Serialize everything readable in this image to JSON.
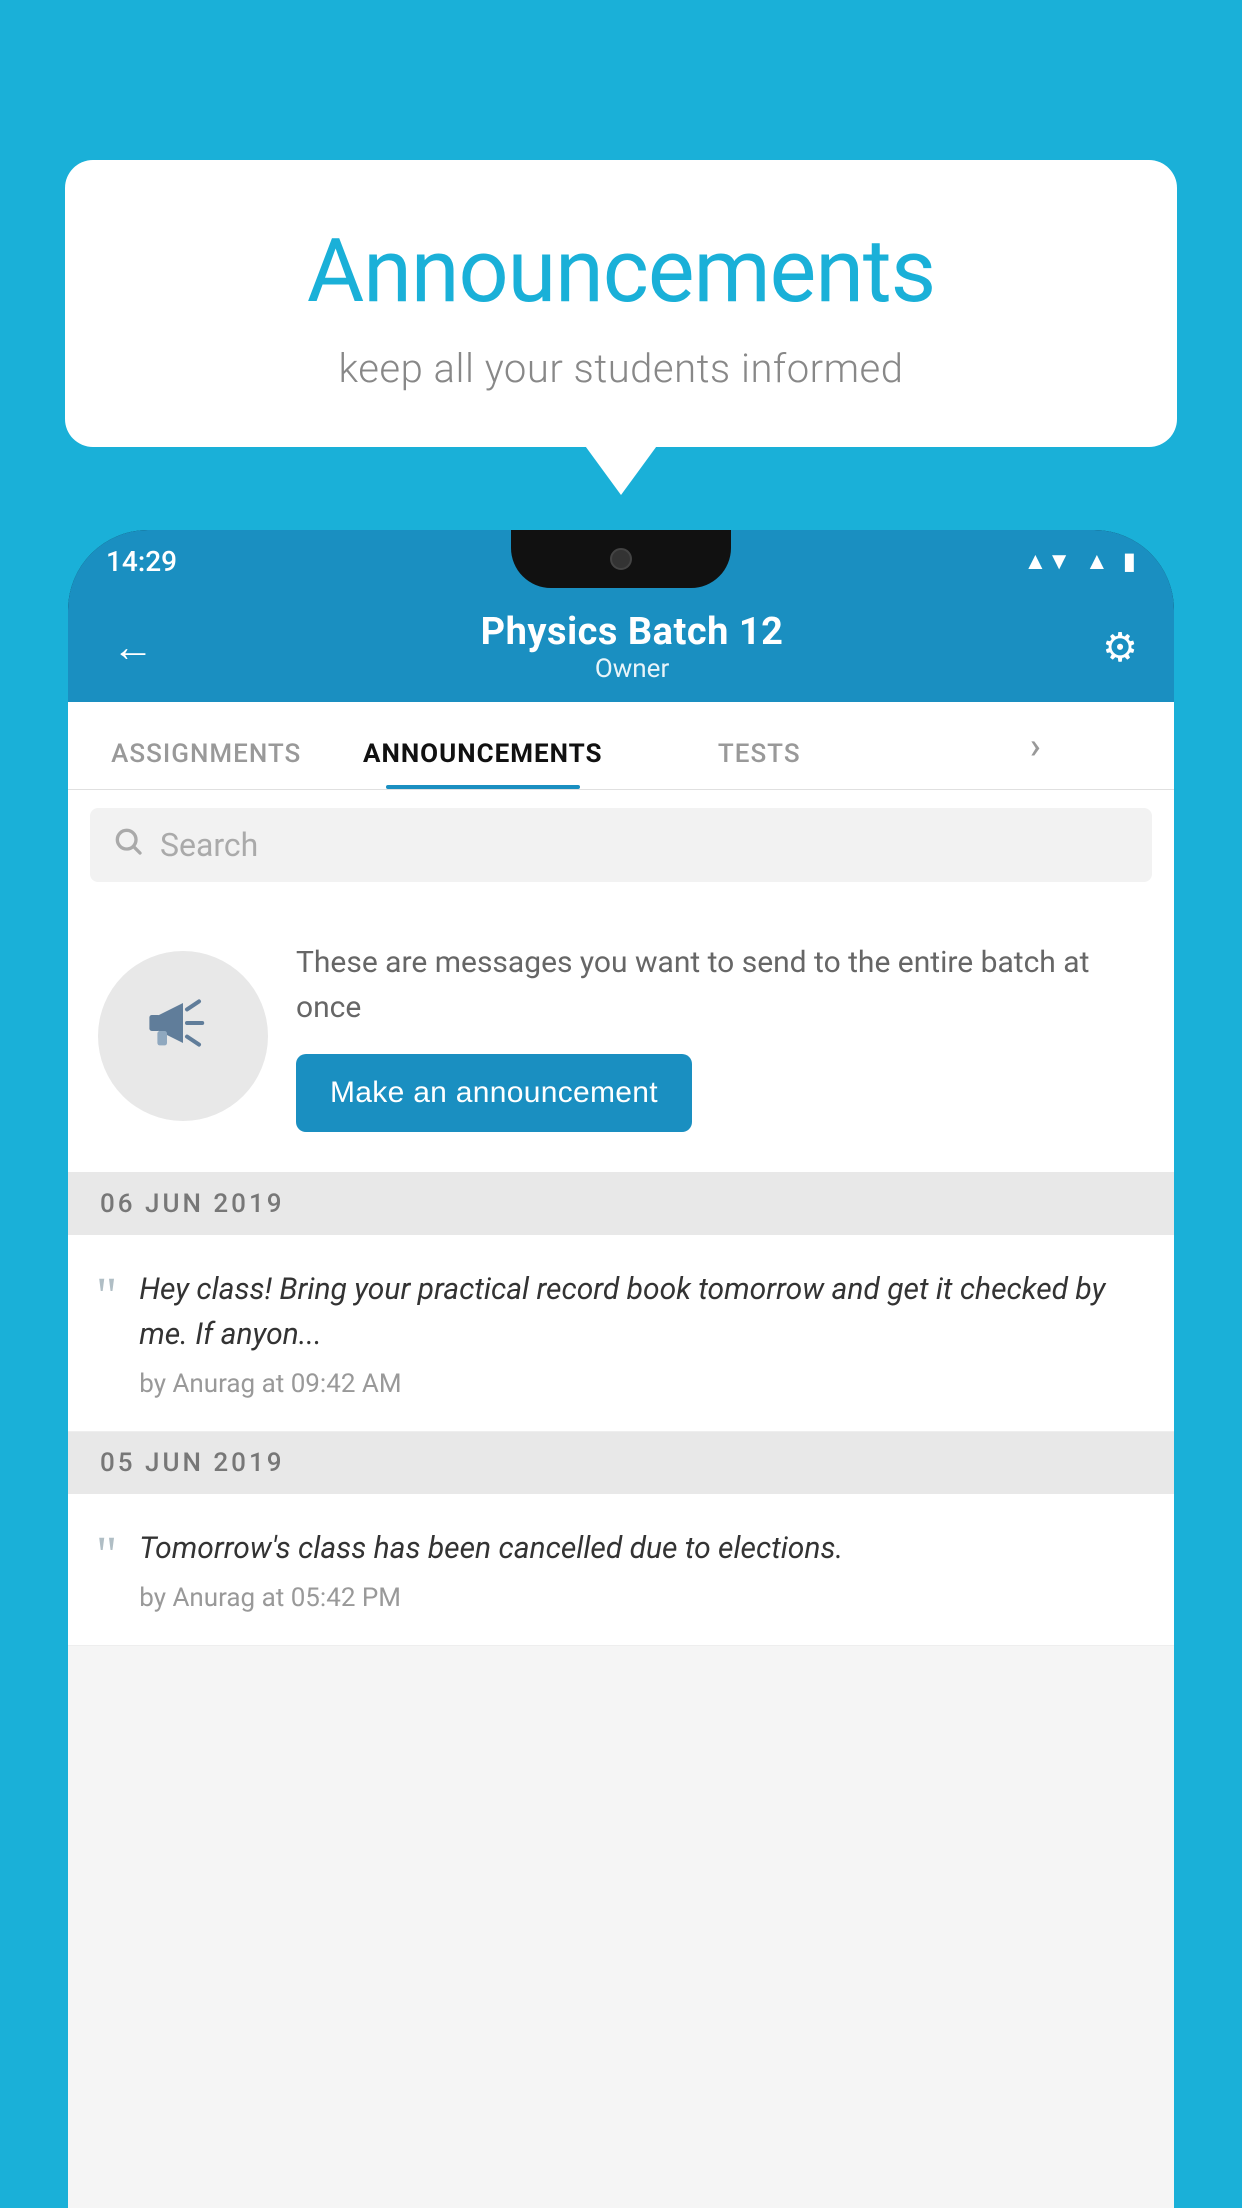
{
  "bubble": {
    "title": "Announcements",
    "subtitle": "keep all your students informed"
  },
  "status_bar": {
    "time": "14:29",
    "wifi": "▼▲",
    "signal": "▲",
    "battery": "▮"
  },
  "app_bar": {
    "title": "Physics Batch 12",
    "subtitle": "Owner",
    "back_label": "←",
    "gear_label": "⚙"
  },
  "tabs": [
    {
      "label": "ASSIGNMENTS",
      "active": false
    },
    {
      "label": "ANNOUNCEMENTS",
      "active": true
    },
    {
      "label": "TESTS",
      "active": false
    },
    {
      "label": "•",
      "active": false
    }
  ],
  "search": {
    "placeholder": "Search"
  },
  "promo": {
    "description": "These are messages you want to send to the entire batch at once",
    "button_label": "Make an announcement"
  },
  "announcements": [
    {
      "date": "06  JUN  2019",
      "message": "Hey class! Bring your practical record book tomorrow and get it checked by me. If anyon...",
      "meta": "by Anurag at 09:42 AM"
    },
    {
      "date": "05  JUN  2019",
      "message": "Tomorrow's class has been cancelled due to elections.",
      "meta": "by Anurag at 05:42 PM"
    }
  ],
  "colors": {
    "primary": "#1a8fc1",
    "background": "#1ab0d8",
    "accent": "#1a8fc1"
  }
}
